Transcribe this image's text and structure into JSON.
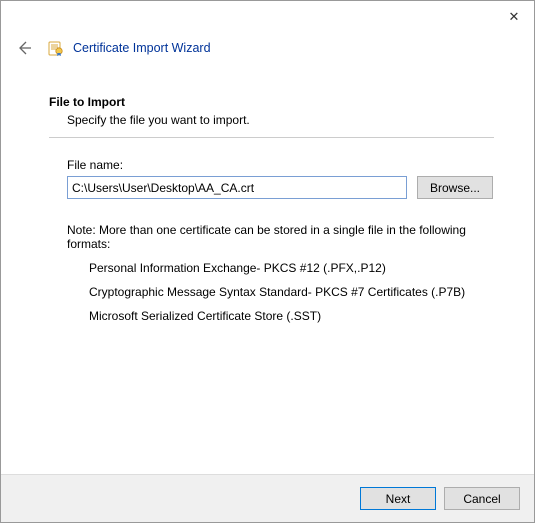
{
  "header": {
    "title": "Certificate Import Wizard"
  },
  "section": {
    "title": "File to Import",
    "subtitle": "Specify the file you want to import."
  },
  "field": {
    "label": "File name:",
    "value": "C:\\Users\\User\\Desktop\\AA_CA.crt",
    "browse_label": "Browse..."
  },
  "note": {
    "intro": "Note:  More than one certificate can be stored in a single file in the following formats:",
    "formats": [
      "Personal Information Exchange- PKCS #12 (.PFX,.P12)",
      "Cryptographic Message Syntax Standard- PKCS #7 Certificates (.P7B)",
      "Microsoft Serialized Certificate Store (.SST)"
    ]
  },
  "footer": {
    "next_label": "Next",
    "cancel_label": "Cancel"
  }
}
